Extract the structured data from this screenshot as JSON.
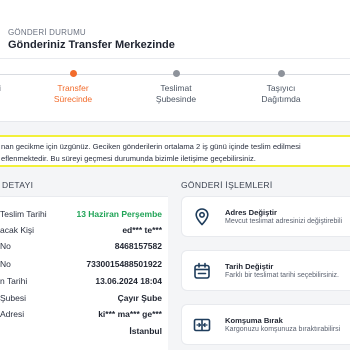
{
  "status": {
    "label": "GÖNDERİ DURUMU",
    "title": "Gönderiniz Transfer Merkezinde"
  },
  "steps": [
    {
      "label": "i",
      "active": false
    },
    {
      "label": "Transfer\nSürecinde",
      "active": true
    },
    {
      "label": "Teslimat\nŞubesinde",
      "active": false
    },
    {
      "label": "Taşıyıcı\nDağıtımda",
      "active": false
    }
  ],
  "warning": {
    "line1": "nan gecikme için üzgünüz. Geciken gönderilerin ortalama 2 iş günü içinde teslim edilmesi",
    "line2": "eflenmektedir. Bu süreyi geçmesi durumunda bizimle iletişime geçebilirsiniz."
  },
  "details": {
    "title": "DETAYI",
    "rows": [
      {
        "key": "Teslim Tarihi",
        "value": "13 Haziran Perşembe"
      },
      {
        "key": "acak Kişi",
        "value": "ed*** te***"
      },
      {
        "key": "No",
        "value": "8468157582"
      },
      {
        "key": "No",
        "value": "7330015488501922"
      },
      {
        "key": "n Tarihi",
        "value": "13.06.2024 18:04"
      },
      {
        "key": "Şubesi",
        "value": "Çayır Şube"
      },
      {
        "key": "Adresi",
        "value": "ki*** ma*** ge***"
      },
      {
        "key": "",
        "value": "İstanbul"
      }
    ]
  },
  "actions": {
    "title": "GÖNDERİ İŞLEMLERİ",
    "items": [
      {
        "title": "Adres Değiştir",
        "subtitle": "Mevcut teslimat adresinizi değiştirebili",
        "icon": "location-pin-icon"
      },
      {
        "title": "Tarih Değiştir",
        "subtitle": "Farklı bir teslimat tarihi seçebilirsiniz.",
        "icon": "calendar-icon"
      },
      {
        "title": "Komşuma Bırak",
        "subtitle": "Kargonuzu komşunuza bıraktırabilirsi",
        "icon": "package-transfer-icon"
      }
    ]
  },
  "colors": {
    "accent": "#f26b2b",
    "success": "#1fa356",
    "highlight": "#f2f03a",
    "icon": "#1f3d5c"
  }
}
